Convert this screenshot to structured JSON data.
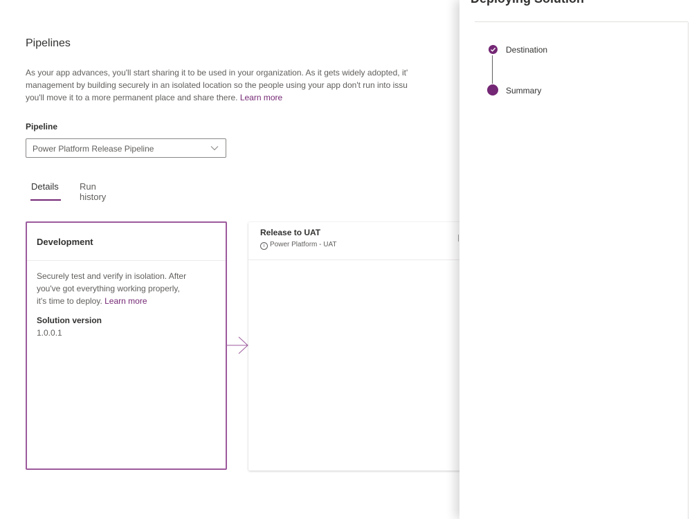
{
  "page": {
    "title": "Pipelines",
    "description_lines": [
      "As your app advances, you'll start sharing it to be used in your organization. As it gets widely adopted, it'",
      "management by building securely in an isolated location so the people using your app don't run into issu",
      "you'll move it to a more permanent place and share there."
    ],
    "learn_more": "Learn more"
  },
  "pipeline": {
    "label": "Pipeline",
    "selected": "Power Platform Release Pipeline",
    "chevron_icon": "chevron-down-icon"
  },
  "tabs": [
    {
      "label": "Details",
      "active": true
    },
    {
      "label": "Run history",
      "active": false
    }
  ],
  "stages": {
    "development": {
      "title": "Development",
      "description_lines": [
        "Securely test and verify in isolation. After",
        "you've got everything working properly,",
        "it's time to deploy."
      ],
      "learn_more": "Learn more",
      "solution_version_label": "Solution version",
      "solution_version": "1.0.0.1"
    },
    "uat": {
      "title": "Release to UAT",
      "environment": "Power Platform - UAT",
      "info_icon": "info-icon"
    }
  },
  "panel": {
    "title": "Deploying Solution",
    "steps": [
      {
        "label": "Destination",
        "status": "completed",
        "icon": "checkmark-icon"
      },
      {
        "label": "Summary",
        "status": "current"
      }
    ]
  },
  "colors": {
    "accent": "#742774",
    "stage_border": "#9c5a9c",
    "text_primary": "#323130",
    "text_secondary": "#605e5c"
  }
}
